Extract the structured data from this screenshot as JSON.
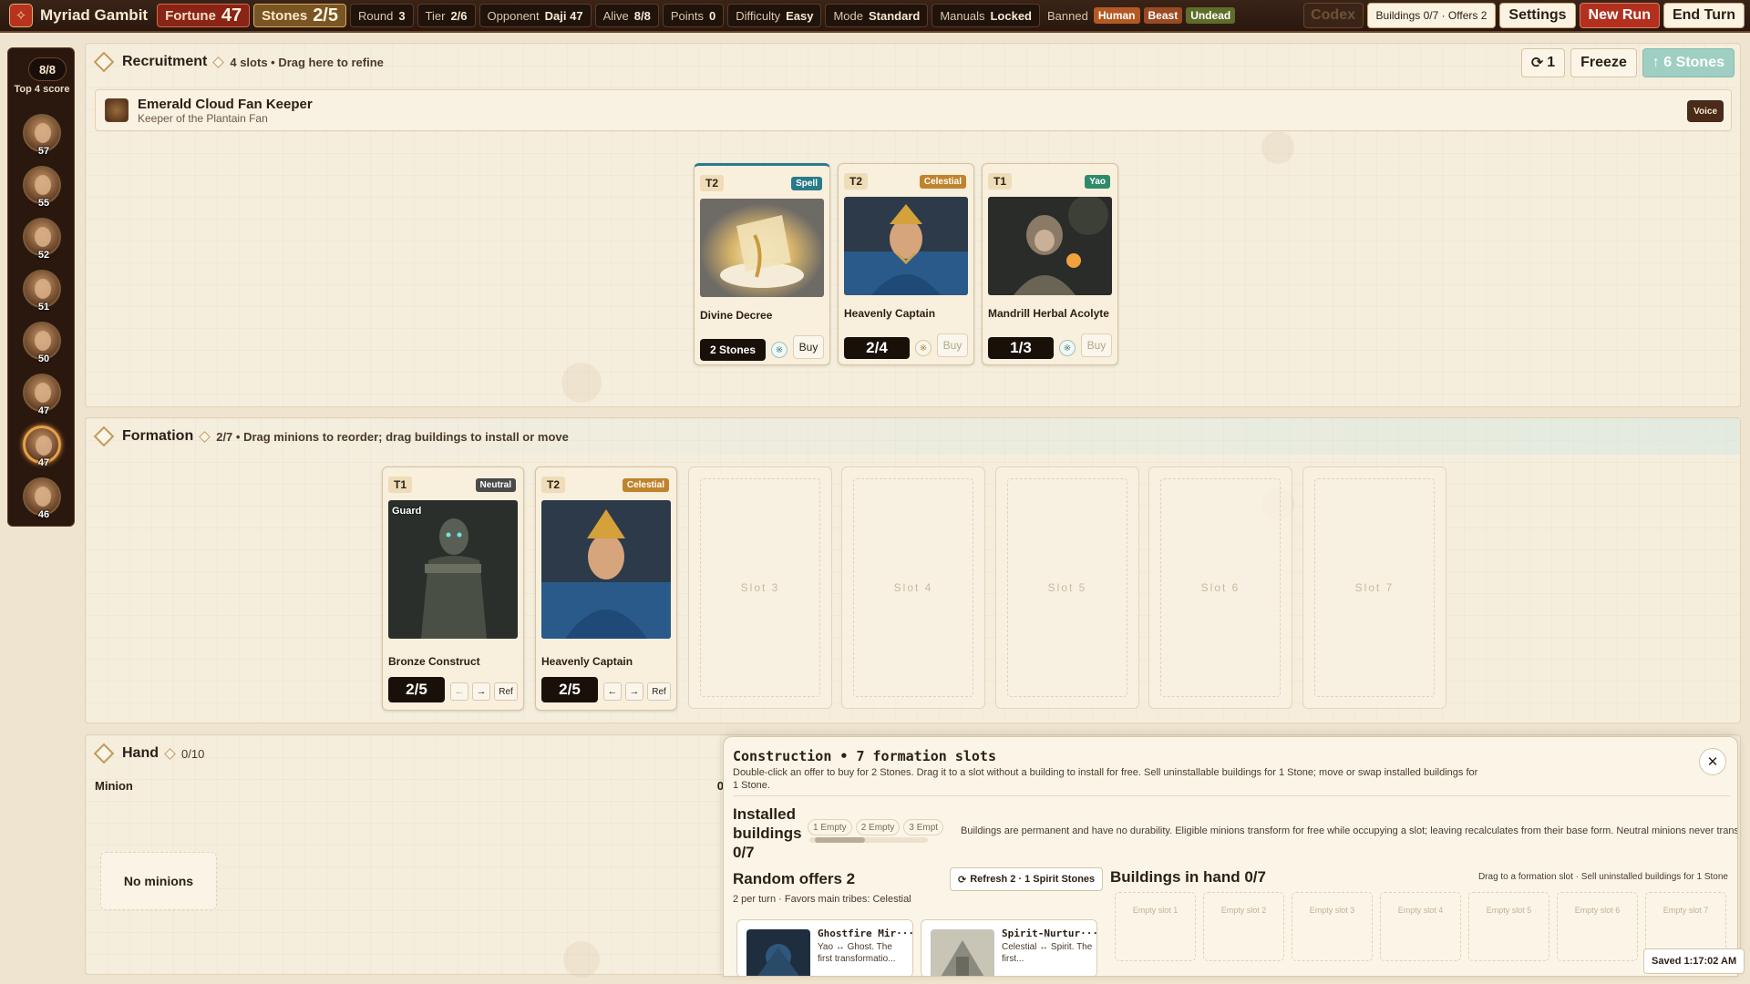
{
  "topbar": {
    "app_title": "Myriad Gambit",
    "fortune_label": "Fortune",
    "fortune_value": "47",
    "stones_label": "Stones",
    "stones_value": "2/5",
    "round_label": "Round",
    "round_value": "3",
    "tier_label": "Tier",
    "tier_value": "2/6",
    "opponent_label": "Opponent",
    "opponent_value": "Daji 47",
    "alive_label": "Alive",
    "alive_value": "8/8",
    "points_label": "Points",
    "points_value": "0",
    "difficulty_label": "Difficulty",
    "difficulty_value": "Easy",
    "mode_label": "Mode",
    "mode_value": "Standard",
    "manuals_label": "Manuals",
    "manuals_value": "Locked",
    "banned_label": "Banned",
    "banned_tribes": [
      "Human",
      "Beast",
      "Undead"
    ],
    "codex_label": "Codex",
    "buildings_label": "Buildings 0/7 · Offers 2",
    "settings_label": "Settings",
    "new_run_label": "New Run",
    "end_turn_label": "End Turn"
  },
  "rail": {
    "count": "8/8",
    "label": "Top 4 score",
    "players": [
      {
        "score": "57",
        "icon": "player-avatar-icon"
      },
      {
        "score": "55",
        "icon": "player-avatar-icon"
      },
      {
        "score": "52",
        "icon": "player-avatar-icon"
      },
      {
        "score": "51",
        "icon": "player-avatar-icon"
      },
      {
        "score": "50",
        "icon": "player-avatar-icon"
      },
      {
        "score": "47",
        "icon": "player-avatar-icon"
      },
      {
        "score": "47",
        "icon": "player-avatar-icon",
        "current": true
      },
      {
        "score": "46",
        "icon": "player-avatar-icon"
      }
    ]
  },
  "recruitment": {
    "title": "Recruitment",
    "subtitle": "4 slots • Drag here to refine",
    "refresh_label": "1",
    "freeze_label": "Freeze",
    "upgrade_label": "↑ 6 Stones",
    "hero": {
      "name": "Emerald Cloud Fan Keeper",
      "desc": "Keeper of the Plantain Fan",
      "voice_label": "Voice"
    },
    "cards": [
      {
        "tier": "T2",
        "tribe": "Spell",
        "name": "Divine Decree",
        "cost": "2 Stones",
        "buy": "Buy"
      },
      {
        "tier": "T2",
        "tribe": "Celestial",
        "name": "Heavenly Captain",
        "cost": "2/4",
        "buy": "Buy"
      },
      {
        "tier": "T1",
        "tribe": "Yao",
        "name": "Mandrill Herbal Acolyte",
        "cost": "1/3",
        "buy": "Buy"
      }
    ]
  },
  "formation": {
    "title": "Formation",
    "subtitle": "2/7 • Drag minions to reorder; drag buildings to install or move",
    "minions": [
      {
        "tier": "T1",
        "tribe": "Neutral",
        "name": "Bronze Construct",
        "stats": "2/5",
        "badge": "Guard",
        "left": "←",
        "right": "→",
        "ref": "Ref"
      },
      {
        "tier": "T2",
        "tribe": "Celestial",
        "name": "Heavenly Captain",
        "stats": "2/5",
        "left": "←",
        "right": "→",
        "ref": "Ref"
      }
    ],
    "empty_slots": [
      "Slot 3",
      "Slot 4",
      "Slot 5",
      "Slot 6",
      "Slot 7"
    ]
  },
  "hand": {
    "title": "Hand",
    "count": "0/10",
    "minion_label": "Minion",
    "minion_count": "0",
    "empty_label": "No minions"
  },
  "construction": {
    "title": "Construction  •  7 formation slots",
    "desc": "Double-click an offer to buy for 2 Stones. Drag it to a slot without a building to install for free. Sell uninstallable buildings for 1 Stone; move or swap installed buildings for 1 Stone.",
    "installed_label": "Installed buildings 0/7",
    "installed_chips": [
      "1 Empty",
      "2 Empty",
      "3 Empt"
    ],
    "installed_note": "Buildings are permanent and have no durability. Eligible minions transform for free while occupying a slot; leaving recalculates from their base form. Neutral minions never transform.",
    "offers_title": "Random offers 2",
    "offers_sub": "2 per turn · Favors main tribes: Celestial",
    "refresh_label": "Refresh 2 · 1 Spirit Stones",
    "offers": [
      {
        "name": "Ghostfire Mir···",
        "desc": "Yao ↔ Ghost. The first transformatio..."
      },
      {
        "name": "Spirit-Nurtur···",
        "desc": "Celestial ↔ Spirit. The first..."
      }
    ],
    "hand_title": "Buildings in hand 0/7",
    "hand_note": "Drag to a formation slot · Sell uninstalled buildings for 1 Stone",
    "hand_slots": [
      "Empty slot 1",
      "Empty slot 2",
      "Empty slot 3",
      "Empty slot 4",
      "Empty slot 5",
      "Empty slot 6",
      "Empty slot 7"
    ]
  },
  "saved_label": "Saved 1:17:02 AM",
  "colors": {
    "spell": "#2b7a8a",
    "celestial": "#c0842c",
    "yao": "#2f8a6a",
    "neutral": "#4a4a4a"
  }
}
